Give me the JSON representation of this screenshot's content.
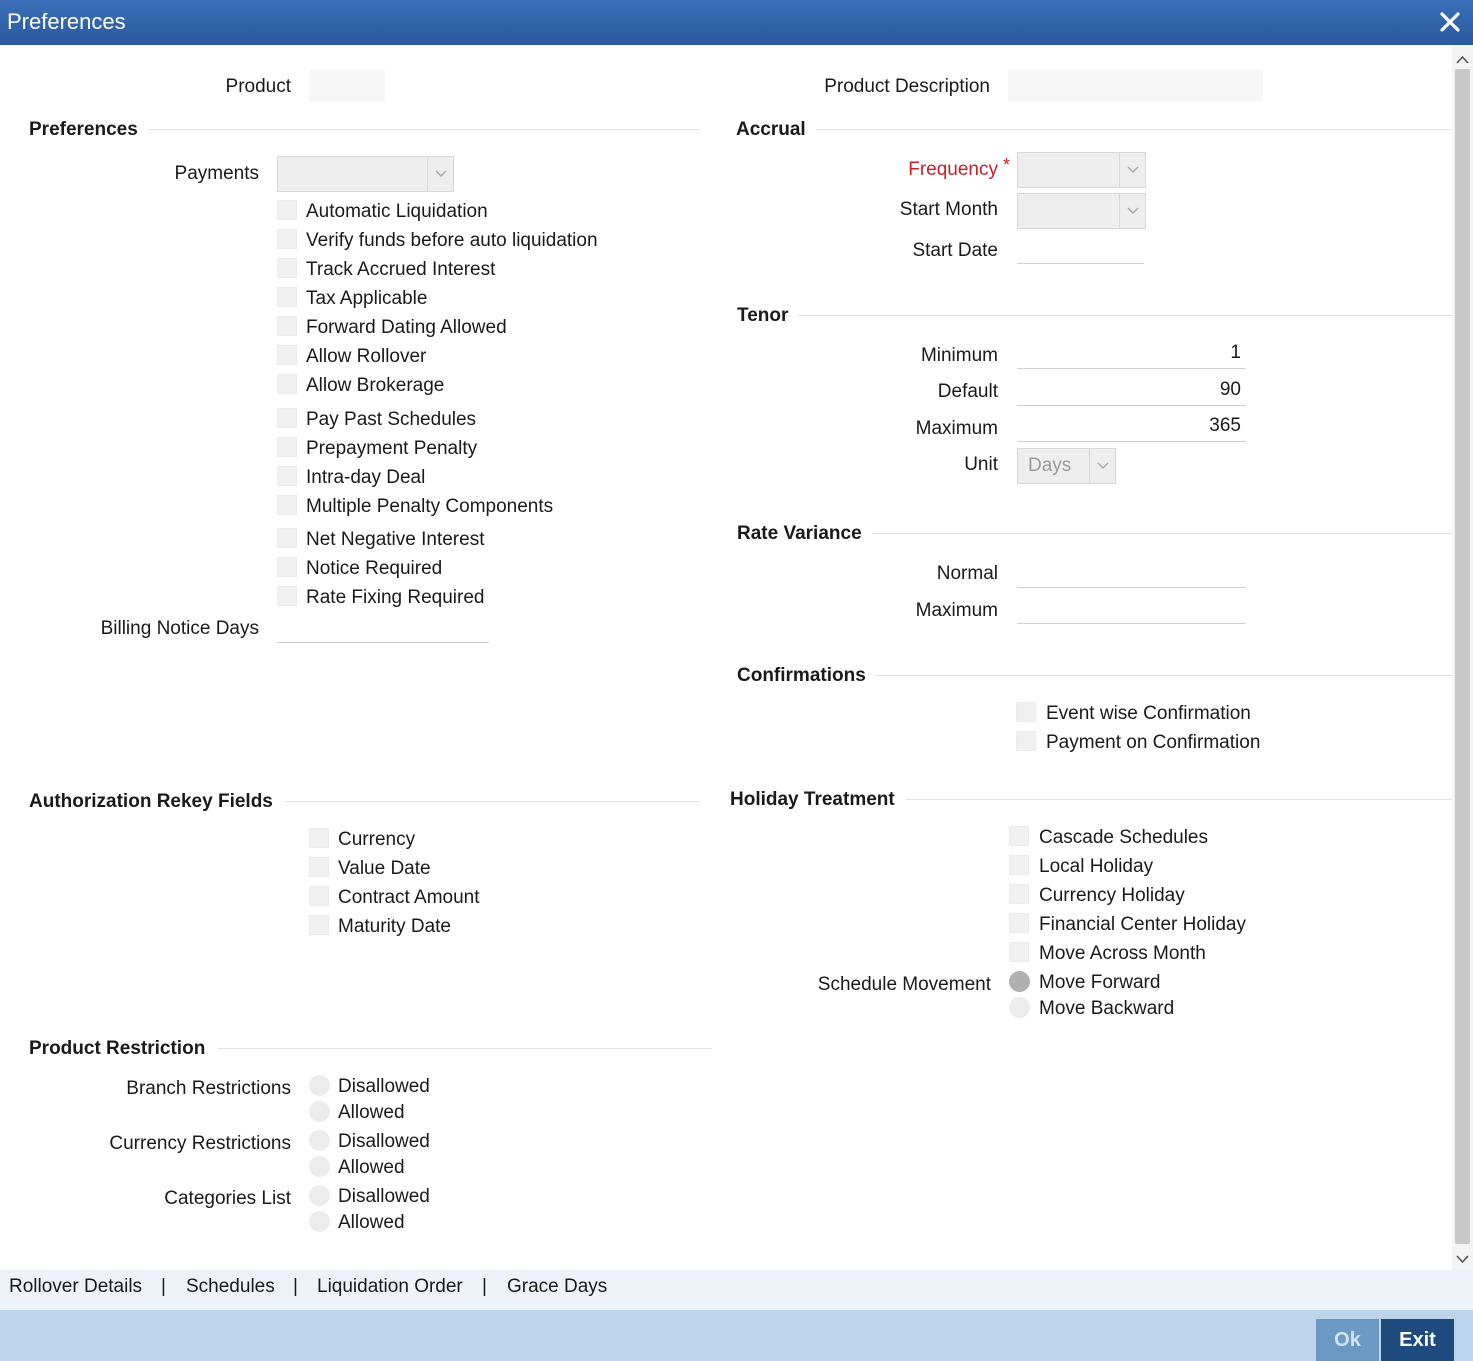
{
  "window": {
    "title": "Preferences"
  },
  "header": {
    "product_label": "Product",
    "product_value": "",
    "product_description_label": "Product Description",
    "product_description_value": ""
  },
  "preferences": {
    "title": "Preferences",
    "payments_label": "Payments",
    "payments_value": "",
    "checkboxes": [
      "Automatic Liquidation",
      "Verify funds before auto liquidation",
      "Track Accrued Interest",
      "Tax Applicable",
      "Forward Dating Allowed",
      "Allow Rollover",
      "Allow Brokerage",
      "Pay Past Schedules",
      "Prepayment Penalty",
      "Intra-day Deal",
      "Multiple Penalty Components",
      "Net Negative Interest",
      "Notice Required",
      "Rate Fixing Required"
    ],
    "billing_notice_days_label": "Billing Notice Days",
    "billing_notice_days_value": ""
  },
  "accrual": {
    "title": "Accrual",
    "frequency_label": "Frequency",
    "required_mark": "*",
    "frequency_value": "",
    "start_month_label": "Start Month",
    "start_month_value": "",
    "start_date_label": "Start Date",
    "start_date_value": ""
  },
  "tenor": {
    "title": "Tenor",
    "minimum_label": "Minimum",
    "minimum_value": "1",
    "default_label": "Default",
    "default_value": "90",
    "maximum_label": "Maximum",
    "maximum_value": "365",
    "unit_label": "Unit",
    "unit_value": "Days"
  },
  "rate_variance": {
    "title": "Rate Variance",
    "normal_label": "Normal",
    "normal_value": "",
    "maximum_label": "Maximum",
    "maximum_value": ""
  },
  "confirmations": {
    "title": "Confirmations",
    "checkboxes": [
      "Event wise Confirmation",
      "Payment on Confirmation"
    ]
  },
  "authorization": {
    "title": "Authorization Rekey Fields",
    "checkboxes": [
      "Currency",
      "Value Date",
      "Contract Amount",
      "Maturity Date"
    ]
  },
  "holiday": {
    "title": "Holiday Treatment",
    "checkboxes": [
      "Cascade Schedules",
      "Local Holiday",
      "Currency Holiday",
      "Financial Center Holiday",
      "Move Across Month"
    ],
    "schedule_movement_label": "Schedule Movement",
    "radios": [
      "Move Forward",
      "Move Backward"
    ],
    "selected": "Move Forward"
  },
  "restriction": {
    "title": "Product Restriction",
    "groups": [
      {
        "label": "Branch Restrictions",
        "options": [
          "Disallowed",
          "Allowed"
        ]
      },
      {
        "label": "Currency Restrictions",
        "options": [
          "Disallowed",
          "Allowed"
        ]
      },
      {
        "label": "Categories List",
        "options": [
          "Disallowed",
          "Allowed"
        ]
      }
    ]
  },
  "tabs": [
    "Rollover Details",
    "Schedules",
    "Liquidation Order",
    "Grace Days"
  ],
  "tab_separator": "|",
  "footer": {
    "ok_label": "Ok",
    "exit_label": "Exit"
  },
  "colors": {
    "titlebar": "#2f62aa",
    "footer": "#bcd5ec",
    "exit": "#1f4a7e",
    "ok": "#6c98c6",
    "required": "#c8202a"
  }
}
